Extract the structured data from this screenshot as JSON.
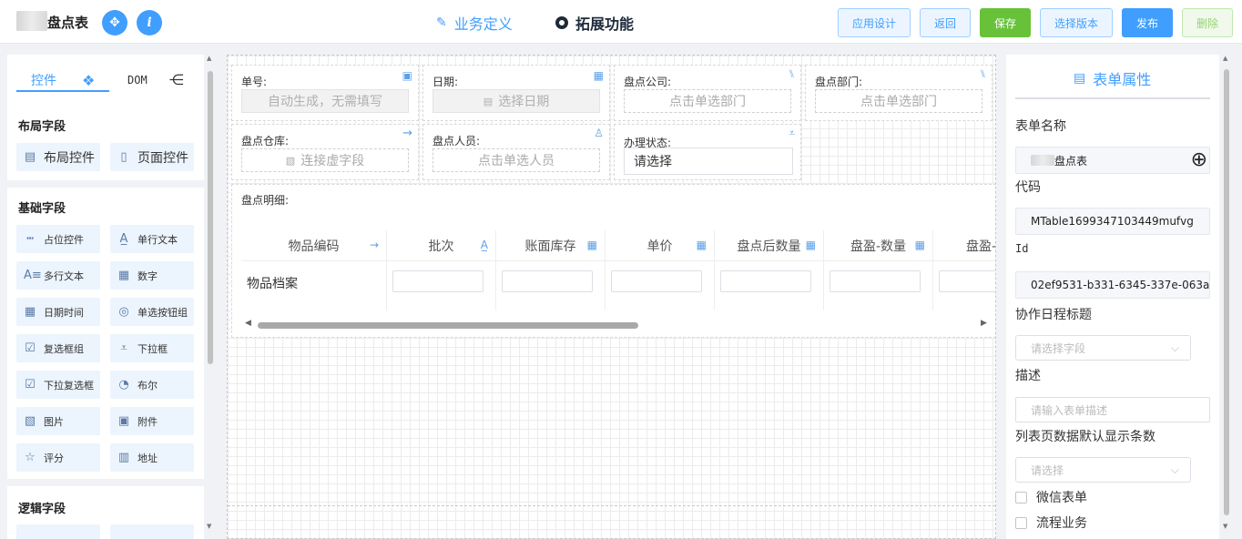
{
  "header": {
    "app_title": "盘点表",
    "tabs": [
      {
        "label": "业务定义",
        "icon": "edit-icon",
        "active": false
      },
      {
        "label": "拓展功能",
        "icon": "radio-dot-icon",
        "active": true
      }
    ],
    "buttons": {
      "app_design": "应用设计",
      "back": "返回",
      "save": "保存",
      "select_version": "选择版本",
      "publish": "发布",
      "delete": "删除"
    }
  },
  "left_panel": {
    "tabs": {
      "controls": "控件",
      "dom": "DOM"
    },
    "sections": {
      "layout": "布局字段",
      "basic": "基础字段",
      "logic": "逻辑字段"
    },
    "layout_items": [
      "布局控件",
      "页面控件"
    ],
    "basic_items": [
      "占位控件",
      "单行文本",
      "多行文本",
      "数字",
      "日期时间",
      "单选按钮组",
      "复选框组",
      "下拉框",
      "下拉复选框",
      "布尔",
      "图片",
      "附件",
      "评分",
      "地址"
    ]
  },
  "form": {
    "fields": {
      "order_no": {
        "label": "单号:",
        "placeholder": "自动生成，无需填写"
      },
      "date": {
        "label": "日期:",
        "placeholder": "选择日期"
      },
      "company": {
        "label": "盘点公司:",
        "placeholder": "点击单选部门"
      },
      "dept": {
        "label": "盘点部门:",
        "placeholder": "点击单选部门"
      },
      "warehouse": {
        "label": "盘点仓库:",
        "placeholder": "连接虚字段"
      },
      "person": {
        "label": "盘点人员:",
        "placeholder": "点击单选人员"
      },
      "status": {
        "label": "办理状态:",
        "value": "请选择"
      }
    },
    "detail": {
      "label": "盘点明细:",
      "columns": [
        "物品编码",
        "批次",
        "账面库存",
        "单价",
        "盘点后数量",
        "盘盈-数量",
        "盘盈-金"
      ],
      "first_cell": "物品档案"
    }
  },
  "right_panel": {
    "title": "表单属性",
    "form_name_label": "表单名称",
    "form_name_value": "盘点表",
    "code_label": "代码",
    "code_value": "MTable1699347103449mufvg",
    "id_label": "Id",
    "id_value": "02ef9531-b331-6345-337e-063a",
    "schedule_title_label": "协作日程标题",
    "schedule_title_placeholder": "请选择字段",
    "desc_label": "描述",
    "desc_placeholder": "请输入表单描述",
    "page_size_label": "列表页数据默认显示条数",
    "page_size_placeholder": "请选择",
    "wechat_form": "微信表单",
    "process_business": "流程业务"
  },
  "colors": {
    "primary": "#409eff",
    "success": "#67c23a",
    "panel_bg": "#ecf4fd"
  }
}
